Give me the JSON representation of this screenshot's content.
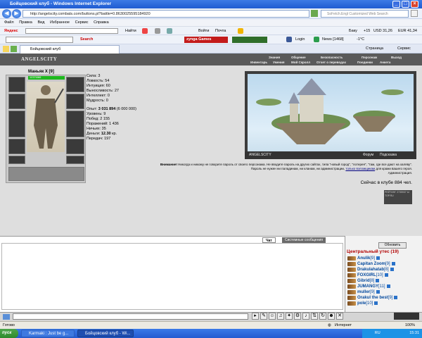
{
  "window": {
    "title": "Бойцовский клуб - Windows Internet Explorer"
  },
  "address": {
    "url": "http://angelscity.combats.com/buttons.pl?battle=0.8630025595184920",
    "web_search_placeholder": "SoFetch.Engl Customized Web Search"
  },
  "menu": [
    "Файл",
    "Правка",
    "Вид",
    "Избранное",
    "Сервис",
    "Справка"
  ],
  "toolbar1": {
    "yandex": "Яндекс",
    "search_field": "Найти",
    "find_label": "Найти",
    "login": "Войти",
    "mail": "Почта",
    "bask": "Баку",
    "temp": "+15",
    "usd": "USD 31,26",
    "eur": "EUR 41,34"
  },
  "toolbar2": {
    "search_label": "Search",
    "zynga": "zynga Games",
    "login": "Login",
    "news": "News [1468]",
    "weather": "-1°C"
  },
  "tab": {
    "label": "Бойцовский клуб",
    "page_menu": "Страница",
    "tools_menu": "Сервис"
  },
  "game": {
    "logo": "ANGELSCITY",
    "nav_top": [
      "Знания",
      "Общение",
      "Безопасность",
      "Персонаж",
      "Выход"
    ],
    "nav_bottom": [
      "Инвентарь",
      "Умения",
      "Мой Скролл",
      "Отчет о переводах",
      "Поединки",
      "Анкета"
    ],
    "character": {
      "name": "Маньяк Х [9]",
      "hp": "1137/1666"
    },
    "stats": [
      "Сила: 3",
      "Ловкость: 54",
      "Интуиция: 60",
      "Выносливость: 27",
      "Интеллект: 0",
      "Мудрость: 0"
    ],
    "experience": {
      "label": "Опыт:",
      "value": "3 031 894",
      "next": "(6 000 000)"
    },
    "stats2": [
      "Уровень: 9",
      "Побед: 2 155",
      "Поражений: 1 436",
      "Ничьих: 35"
    ],
    "money": {
      "label": "Деньги:",
      "value": "12.30",
      "unit": "кр."
    },
    "transfers": "Передач: 197",
    "scene_buttons": {
      "name": "ANGELSCITY",
      "forum": "Форум",
      "hint": "Подсказка"
    },
    "warning": {
      "bold": "Внимание!",
      "text": "Никогда и никому не говорите пароль от своего персонажа. Не вводите пароль на других сайтах, типа \"новый город\", \"лотерея\", \"там, где все дают на халяву\". Пароль не нужен ни паладинам, ни кланам, ни администрации,",
      "link": "только взломщикам",
      "tail": "для кражи вашего героя.",
      "signature": "Администрация."
    },
    "online": "Сейчас в клубе 884 чел.",
    "counter": "РЕЙТИНГ 2735937 Ы TOP.RU"
  },
  "chat": {
    "tabs": [
      "Чат",
      "Системные сообщения"
    ],
    "refresh": "Обновить",
    "room": "Центральный утес (19)",
    "users": [
      {
        "name": "Anulik",
        "level": "[9]"
      },
      {
        "name": "Capitan Zoom",
        "level": "[9]"
      },
      {
        "name": "Drakulahatab",
        "level": "[8]"
      },
      {
        "name": "FOXGIRL",
        "level": "[10]"
      },
      {
        "name": "Gibrid",
        "level": "[8]"
      },
      {
        "name": "JUMANGY",
        "level": "[11]"
      },
      {
        "name": "muller",
        "level": "[9]"
      },
      {
        "name": "Orakul the best",
        "level": "[9]"
      },
      {
        "name": "pole",
        "level": "[10]"
      }
    ]
  },
  "status": {
    "ready": "Готово",
    "zone": "Интернет",
    "zoom": "100%"
  },
  "taskbar": {
    "start": "пуск",
    "tasks": [
      "Karmaki : Just be g...",
      "Бойцовский клуб - Wi..."
    ],
    "lang": "RU",
    "clock": "15:31"
  }
}
